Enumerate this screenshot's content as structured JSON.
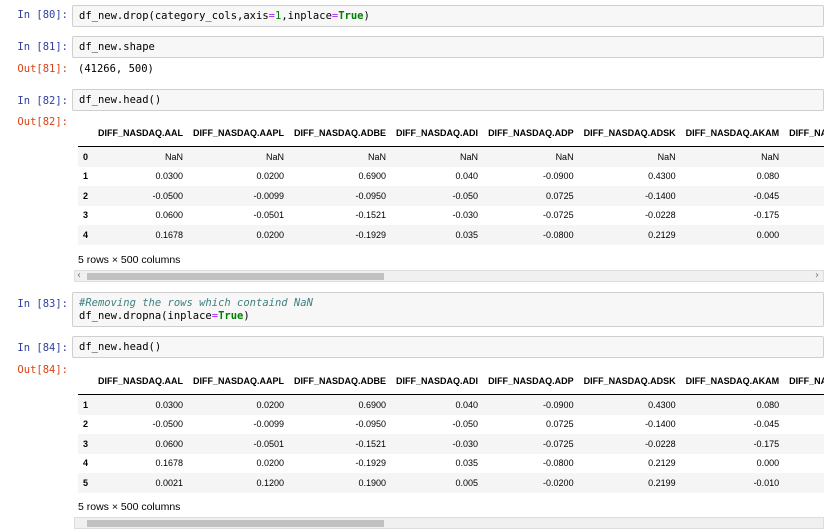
{
  "cells": [
    {
      "in_prompt": "In [80]:",
      "code": "df_new.drop(category_cols,axis=1,inplace=True)"
    },
    {
      "in_prompt": "In [81]:",
      "code": "df_new.shape",
      "out_prompt": "Out[81]:",
      "output": "(41266, 500)"
    },
    {
      "in_prompt": "In [82]:",
      "code": "df_new.head()",
      "out_prompt": "Out[82]:",
      "footer": "5 rows × 500 columns"
    },
    {
      "in_prompt": "In [83]:",
      "comment": "#Removing the rows which containd NaN",
      "code": "df_new.dropna(inplace=True)"
    },
    {
      "in_prompt": "In [84]:",
      "code": "df_new.head()",
      "out_prompt": "Out[84]:",
      "footer": "5 rows × 500 columns"
    }
  ],
  "columns": [
    "DIFF_NASDAQ.AAL",
    "DIFF_NASDAQ.AAPL",
    "DIFF_NASDAQ.ADBE",
    "DIFF_NASDAQ.ADI",
    "DIFF_NASDAQ.ADP",
    "DIFF_NASDAQ.ADSK",
    "DIFF_NASDAQ.AKAM",
    "DIFF_NAS"
  ],
  "table1": [
    {
      "index": "0",
      "values": [
        "NaN",
        "NaN",
        "NaN",
        "NaN",
        "NaN",
        "NaN",
        "NaN"
      ]
    },
    {
      "index": "1",
      "values": [
        "0.0300",
        "0.0200",
        "0.6900",
        "0.040",
        "-0.0900",
        "0.4300",
        "0.080"
      ]
    },
    {
      "index": "2",
      "values": [
        "-0.0500",
        "-0.0099",
        "-0.0950",
        "-0.050",
        "0.0725",
        "-0.1400",
        "-0.045"
      ]
    },
    {
      "index": "3",
      "values": [
        "0.0600",
        "-0.0501",
        "-0.1521",
        "-0.030",
        "-0.0725",
        "-0.0228",
        "-0.175"
      ]
    },
    {
      "index": "4",
      "values": [
        "0.1678",
        "0.0200",
        "-0.1929",
        "0.035",
        "-0.0800",
        "0.2129",
        "0.000"
      ]
    }
  ],
  "table2": [
    {
      "index": "1",
      "values": [
        "0.0300",
        "0.0200",
        "0.6900",
        "0.040",
        "-0.0900",
        "0.4300",
        "0.080"
      ]
    },
    {
      "index": "2",
      "values": [
        "-0.0500",
        "-0.0099",
        "-0.0950",
        "-0.050",
        "0.0725",
        "-0.1400",
        "-0.045"
      ]
    },
    {
      "index": "3",
      "values": [
        "0.0600",
        "-0.0501",
        "-0.1521",
        "-0.030",
        "-0.0725",
        "-0.0228",
        "-0.175"
      ]
    },
    {
      "index": "4",
      "values": [
        "0.1678",
        "0.0200",
        "-0.1929",
        "0.035",
        "-0.0800",
        "0.2129",
        "0.000"
      ]
    },
    {
      "index": "5",
      "values": [
        "0.0021",
        "0.1200",
        "0.1900",
        "0.005",
        "-0.0200",
        "0.2199",
        "-0.010"
      ]
    }
  ],
  "scrollbar": {
    "left_arrow": "‹",
    "right_arrow": "›"
  }
}
